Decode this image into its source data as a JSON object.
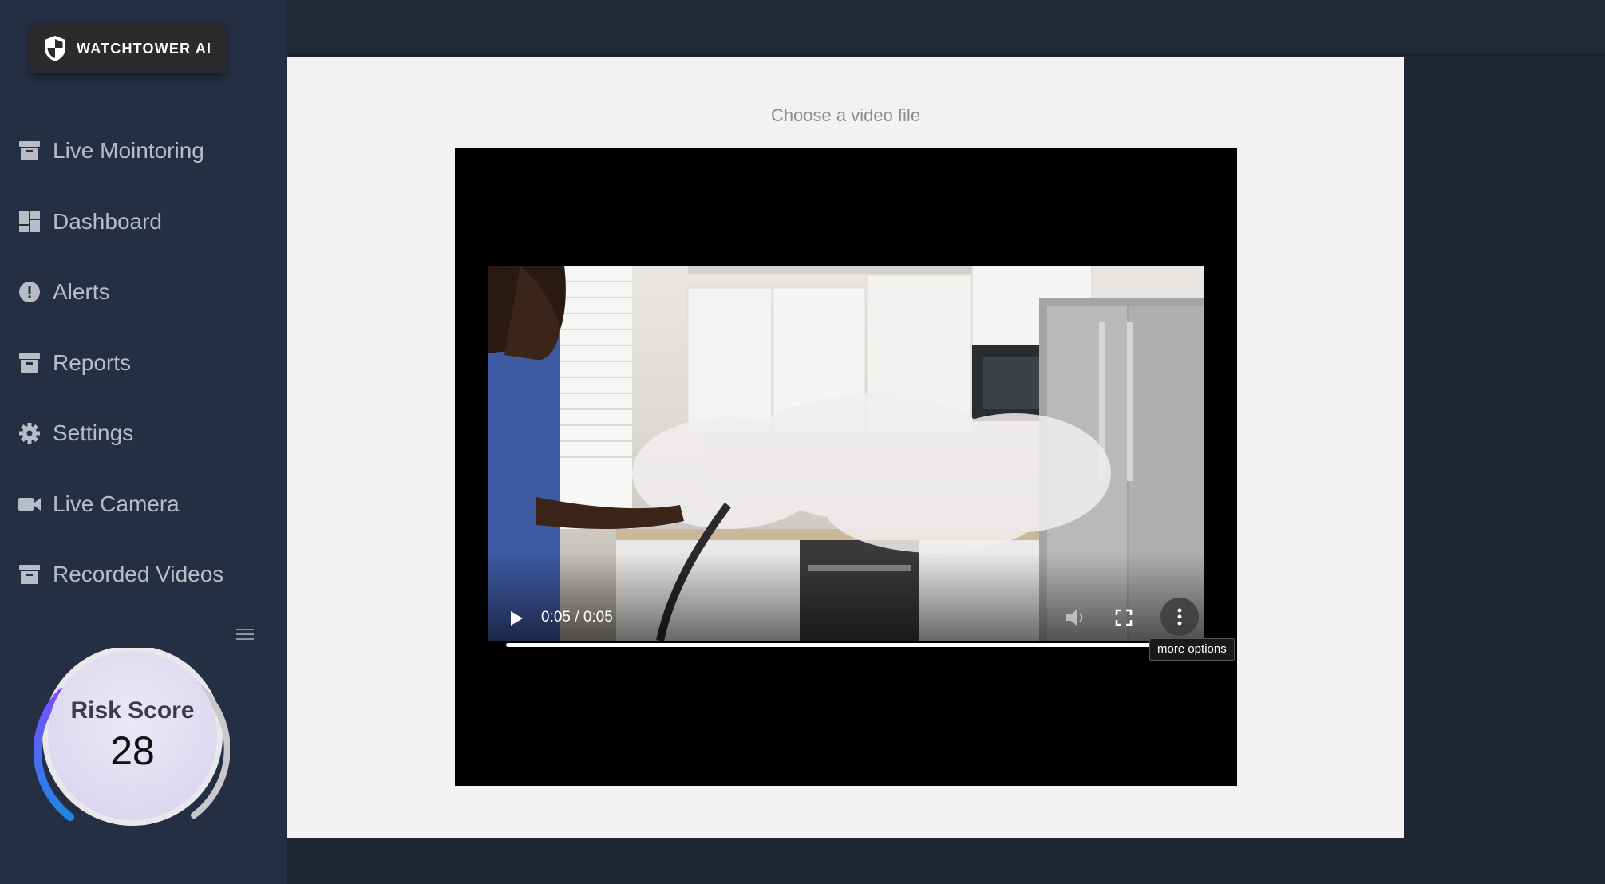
{
  "brand": {
    "name": "WATCHTOWER AI",
    "icon": "shield-icon"
  },
  "sidebar": {
    "items": [
      {
        "label": "Live Mointoring",
        "icon": "archive-icon"
      },
      {
        "label": "Dashboard",
        "icon": "dashboard-icon"
      },
      {
        "label": "Alerts",
        "icon": "alert-icon"
      },
      {
        "label": "Reports",
        "icon": "archive-icon"
      },
      {
        "label": "Settings",
        "icon": "gear-icon"
      },
      {
        "label": "Live Camera",
        "icon": "video-camera-icon"
      },
      {
        "label": "Recorded Videos",
        "icon": "archive-icon"
      }
    ],
    "collapse_icon": "menu-icon"
  },
  "risk": {
    "title": "Risk Score",
    "value": "28",
    "level_percent": 28
  },
  "main": {
    "choose_file_label": "Choose a video file",
    "video": {
      "time": "0:05 / 0:05",
      "progress_percent": 100,
      "more_options_tooltip": "more options",
      "icons": [
        "play-icon",
        "volume-icon",
        "fullscreen-icon",
        "more-vert-icon"
      ]
    }
  },
  "colors": {
    "sidebar_bg": "#252f44",
    "page_bg": "#1f2636",
    "panel_bg": "#f2f2f2",
    "risk_gradient_start": "#7c4dff",
    "risk_gradient_end": "#1e88e5"
  }
}
